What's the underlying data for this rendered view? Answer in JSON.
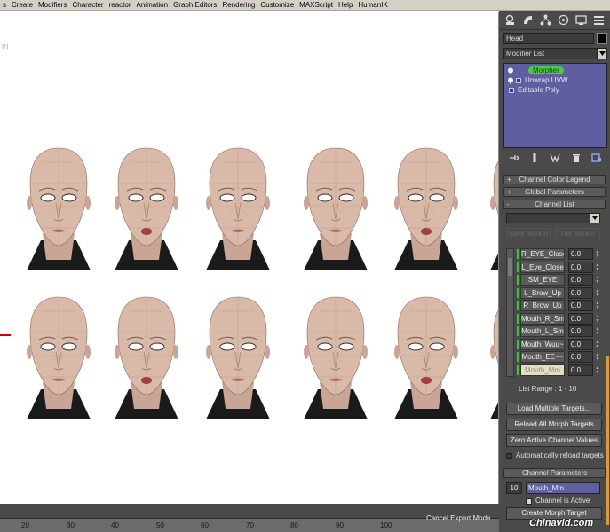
{
  "menu": {
    "items": [
      "s",
      "Create",
      "Modifiers",
      "Character",
      "reactor",
      "Animation",
      "Graph Editors",
      "Rendering",
      "Customize",
      "MAXScript",
      "Help",
      "HumanIK"
    ]
  },
  "viewport": {
    "label": "m",
    "row1_heads": 6,
    "row2_heads": 6,
    "skin_color": "#d9b9a8"
  },
  "timeline": {
    "ticks": [
      "20",
      "30",
      "40",
      "50",
      "60",
      "70",
      "80",
      "90",
      "100"
    ]
  },
  "panel": {
    "tab_icons": [
      "create-icon",
      "modify-icon",
      "hierarchy-icon",
      "motion-icon",
      "display-icon",
      "utilities-icon"
    ],
    "object_name": "Head",
    "modifier_list": "Modifier List",
    "stack": [
      {
        "label": "Morpher",
        "active": true
      },
      {
        "label": "Unwrap UVW",
        "active": false
      },
      {
        "label": "Editable Poly",
        "active": false
      }
    ],
    "rollouts": {
      "legend": "Channel Color Legend",
      "global": "Global Parameters",
      "channel_list": "Channel List",
      "channel_params": "Channel Parameters"
    },
    "rollout_signs": {
      "legend": "+",
      "global": "+",
      "channel_list": "-",
      "channel_params": "-"
    },
    "save_marker": "Save Marker",
    "del_marker": "Del Marker",
    "channels": [
      {
        "name": "R_EYE_Close",
        "value": "0.0"
      },
      {
        "name": "L_Eye_Close",
        "value": "0.0"
      },
      {
        "name": "SM_EYE",
        "value": "0.0"
      },
      {
        "name": "L_Brow_Up",
        "value": "0.0"
      },
      {
        "name": "R_Brow_Up",
        "value": "0.0"
      },
      {
        "name": "Mouth_R_Sm",
        "value": "0.0"
      },
      {
        "name": "Mouth_L_Sm",
        "value": "0.0"
      },
      {
        "name": "Mouth_Wuu~~",
        "value": "0.0"
      },
      {
        "name": "Mouth_EE~~",
        "value": "0.0"
      },
      {
        "name": "Mouth_Mm",
        "value": "0.0"
      }
    ],
    "list_range": "List Range :    1 - 10",
    "load_multiple": "Load Multiple Targets...",
    "reload_all": "Reload All Morph Targets",
    "zero_active": "Zero Active Channel Values",
    "auto_reload": "Automatically reload targets",
    "channel_number": "10",
    "channel_name": "Mouth_Mm",
    "channel_active": "Channel is Active",
    "create_target": "Create Morph Target"
  },
  "status": {
    "expert": "Cancel Expert Mode"
  },
  "watermark": "Chinavid.com",
  "colors": {
    "panel_bg": "#4a4a4a",
    "stack_bg": "#5e5ea0",
    "active_modifier": "#4fc84f",
    "channel_bar": "#2ecc2e"
  }
}
